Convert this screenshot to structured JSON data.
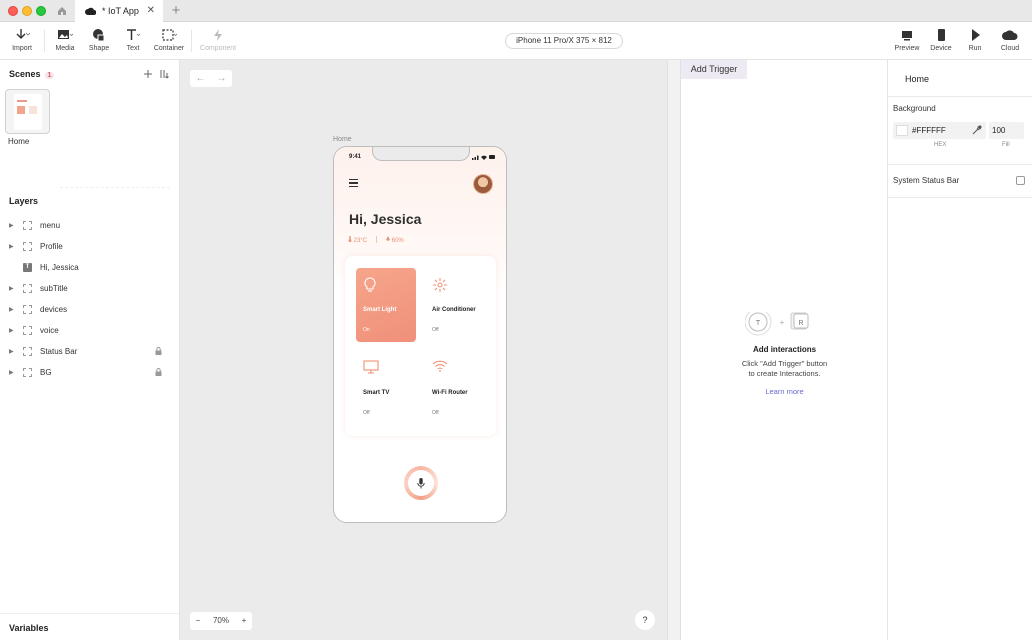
{
  "tabbar": {
    "doc_tab_label": "* IoT App",
    "close_glyph": "✕",
    "new_tab_glyph": "+"
  },
  "toolbar": {
    "import": "Import",
    "media": "Media",
    "shape": "Shape",
    "text": "Text",
    "container": "Container",
    "component": "Component",
    "device": "iPhone 11 Pro/X  375 × 812",
    "preview": "Preview",
    "device_btn": "Device",
    "run": "Run",
    "cloud": "Cloud"
  },
  "scenes": {
    "title": "Scenes",
    "count": "1",
    "items": [
      {
        "label": "Home"
      }
    ]
  },
  "layers": {
    "title": "Layers",
    "items": [
      {
        "label": "menu"
      },
      {
        "label": "Profile"
      },
      {
        "label": "Hi, Jessica"
      },
      {
        "label": "subTitle"
      },
      {
        "label": "devices"
      },
      {
        "label": "voice"
      },
      {
        "label": "Status Bar"
      },
      {
        "label": "BG"
      }
    ]
  },
  "variables": {
    "title": "Variables"
  },
  "canvas": {
    "frame_label": "Home",
    "zoom_value": "70%",
    "zoom_minus": "−",
    "zoom_plus": "+",
    "help": "?",
    "nav_back": "←",
    "nav_forward": "→"
  },
  "phone": {
    "time": "9:41",
    "greeting": "Hi, Jessica",
    "temperature": "23°C",
    "humidity": "60%",
    "devices": [
      {
        "name": "Smart Light",
        "state": "On"
      },
      {
        "name": "Air Conditioner",
        "state": "Off"
      },
      {
        "name": "Smart TV",
        "state": "Off"
      },
      {
        "name": "Wi-Fi Router",
        "state": "Off"
      }
    ]
  },
  "interaction": {
    "add_trigger": "Add Trigger",
    "t_glyph": "T",
    "r_glyph": "R",
    "plus_glyph": "+",
    "heading": "Add interactions",
    "desc_line1": "Click \"Add Trigger\" button",
    "desc_line2": "to create Interactions.",
    "learn_more": "Learn more"
  },
  "properties": {
    "title": "Home",
    "background_label": "Background",
    "hex_value": "#FFFFFF",
    "fill_value": "100",
    "hex_caption": "HEX",
    "fill_caption": "Fill",
    "status_bar_label": "System Status Bar"
  },
  "colors": {
    "accent": "#f29a82",
    "link": "#6b6bd0",
    "badge": "#d05a6b"
  }
}
